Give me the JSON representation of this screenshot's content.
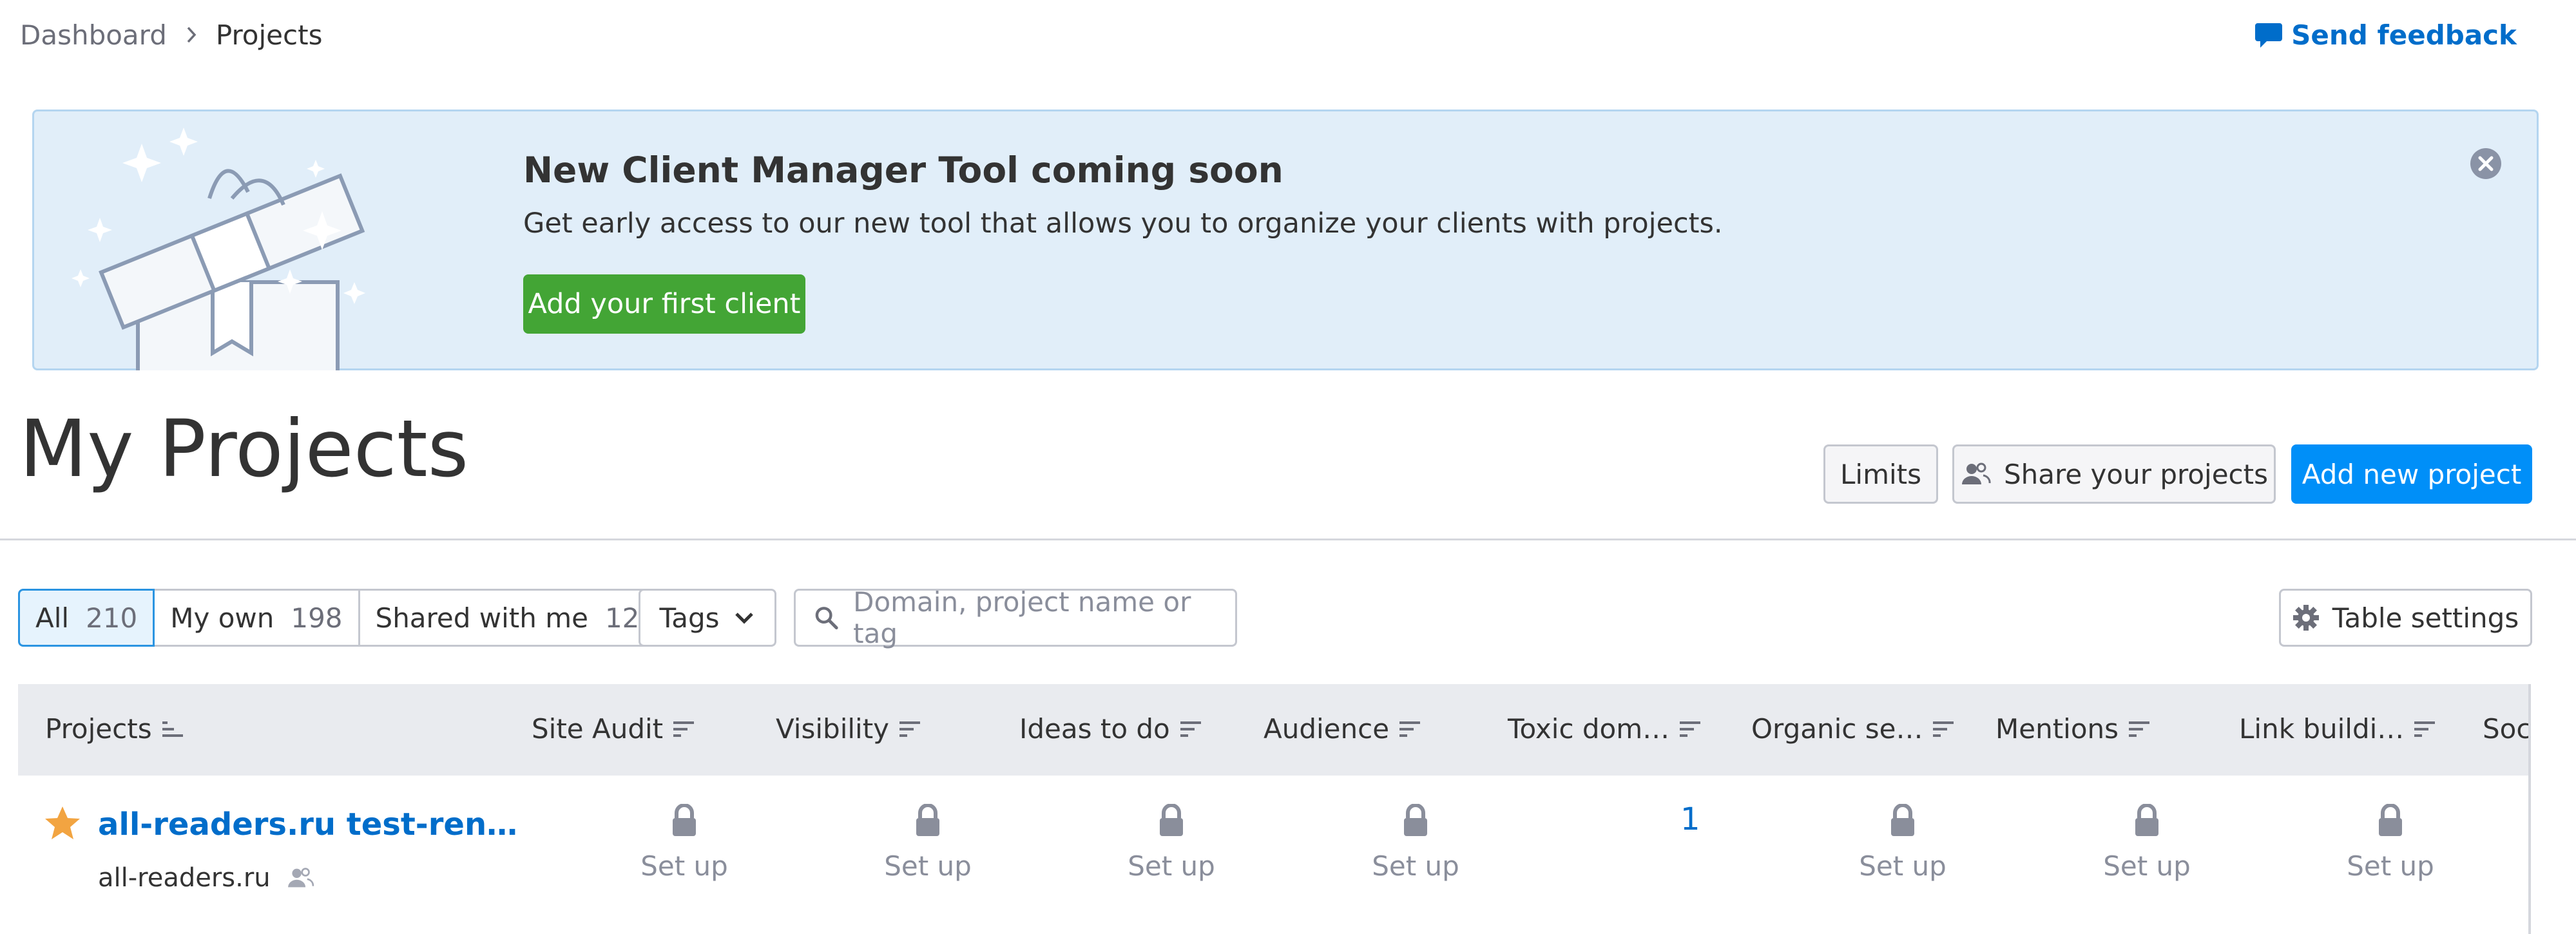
{
  "breadcrumb": {
    "items": [
      "Dashboard",
      "Projects"
    ]
  },
  "header": {
    "feedback_label": "Send feedback"
  },
  "banner": {
    "title": "New Client Manager Tool coming soon",
    "text": "Get early access to our new tool that allows you to organize your clients with projects.",
    "button_label": "Add your first client"
  },
  "page": {
    "title": "My Projects"
  },
  "toolbar": {
    "limits_label": "Limits",
    "share_label": "Share your projects",
    "add_label": "Add new project"
  },
  "filters": {
    "segments": [
      {
        "label": "All",
        "count": "210",
        "active": true
      },
      {
        "label": "My own",
        "count": "198",
        "active": false
      },
      {
        "label": "Shared with me",
        "count": "12",
        "active": false
      }
    ],
    "tags_label": "Tags",
    "search_placeholder": "Domain, project name or tag",
    "table_settings_label": "Table settings"
  },
  "table": {
    "columns": [
      "Projects",
      "Site Audit",
      "Visibility",
      "Ideas to do",
      "Audience",
      "Toxic dom…",
      "Organic se…",
      "Mentions",
      "Link buildi…",
      "Soci"
    ],
    "rows": [
      {
        "name": "all-readers.ru test-ren…",
        "domain": "all-readers.ru",
        "starred": true,
        "setup_label": "Set up",
        "toxic_domains": "1"
      }
    ]
  },
  "colors": {
    "accent": "#008ff8",
    "link": "#006dca",
    "success": "#43a535",
    "banner_bg": "#e1eef9",
    "star": "#f2a441"
  },
  "icons": [
    "chevron-right-icon",
    "feedback-icon",
    "close-icon",
    "share-users-icon",
    "chevron-down-icon",
    "search-icon",
    "gear-icon",
    "sort-icon",
    "star-icon",
    "lock-icon",
    "shared-icon",
    "gift-illustration"
  ]
}
